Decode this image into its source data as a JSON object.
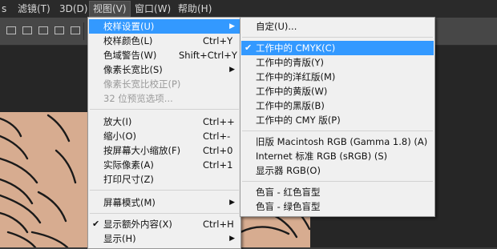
{
  "menubar": {
    "items": [
      {
        "label": "s"
      },
      {
        "label": "滤镜(T)"
      },
      {
        "label": "3D(D)"
      },
      {
        "label": "视图(V)"
      },
      {
        "label": "窗口(W)"
      },
      {
        "label": "帮助(H)"
      }
    ]
  },
  "view_menu": {
    "items": [
      {
        "label": "校样设置(U)",
        "shortcut": "",
        "submenu": true,
        "highlighted": true
      },
      {
        "label": "校样颜色(L)",
        "shortcut": "Ctrl+Y"
      },
      {
        "label": "色域警告(W)",
        "shortcut": "Shift+Ctrl+Y"
      },
      {
        "label": "像素长宽比(S)",
        "shortcut": "",
        "submenu": true
      },
      {
        "label": "像素长宽比校正(P)",
        "shortcut": "",
        "disabled": true
      },
      {
        "label": "32 位预览选项...",
        "shortcut": "",
        "disabled": true
      },
      {
        "label": "放大(I)",
        "shortcut": "Ctrl++"
      },
      {
        "label": "缩小(O)",
        "shortcut": "Ctrl+-"
      },
      {
        "label": "按屏幕大小缩放(F)",
        "shortcut": "Ctrl+0"
      },
      {
        "label": "实际像素(A)",
        "shortcut": "Ctrl+1"
      },
      {
        "label": "打印尺寸(Z)",
        "shortcut": ""
      },
      {
        "label": "屏幕模式(M)",
        "shortcut": "",
        "submenu": true
      },
      {
        "label": "显示额外内容(X)",
        "shortcut": "Ctrl+H",
        "checked": true
      },
      {
        "label": "显示(H)",
        "shortcut": "",
        "submenu": true
      }
    ]
  },
  "proof_submenu": {
    "items": [
      {
        "label": "自定(U)..."
      },
      {
        "label": "工作中的 CMYK(C)",
        "checked": true,
        "highlighted": true
      },
      {
        "label": "工作中的青版(Y)"
      },
      {
        "label": "工作中的洋红版(M)"
      },
      {
        "label": "工作中的黄版(W)"
      },
      {
        "label": "工作中的黑版(B)"
      },
      {
        "label": "工作中的 CMY 版(P)"
      },
      {
        "label": "旧版 Macintosh RGB (Gamma 1.8) (A)"
      },
      {
        "label": "Internet 标准 RGB (sRGB) (S)"
      },
      {
        "label": "显示器 RGB(O)"
      },
      {
        "label": "色盲 - 红色盲型"
      },
      {
        "label": "色盲 - 绿色盲型"
      }
    ]
  },
  "glyphs": {
    "check": "✔",
    "arrow": "▶"
  },
  "colors": {
    "highlight": "#3399ff",
    "menu_bg": "#f0f0f0",
    "menubar_bg": "#2a2a2a",
    "canvas": "#d7ac90"
  }
}
